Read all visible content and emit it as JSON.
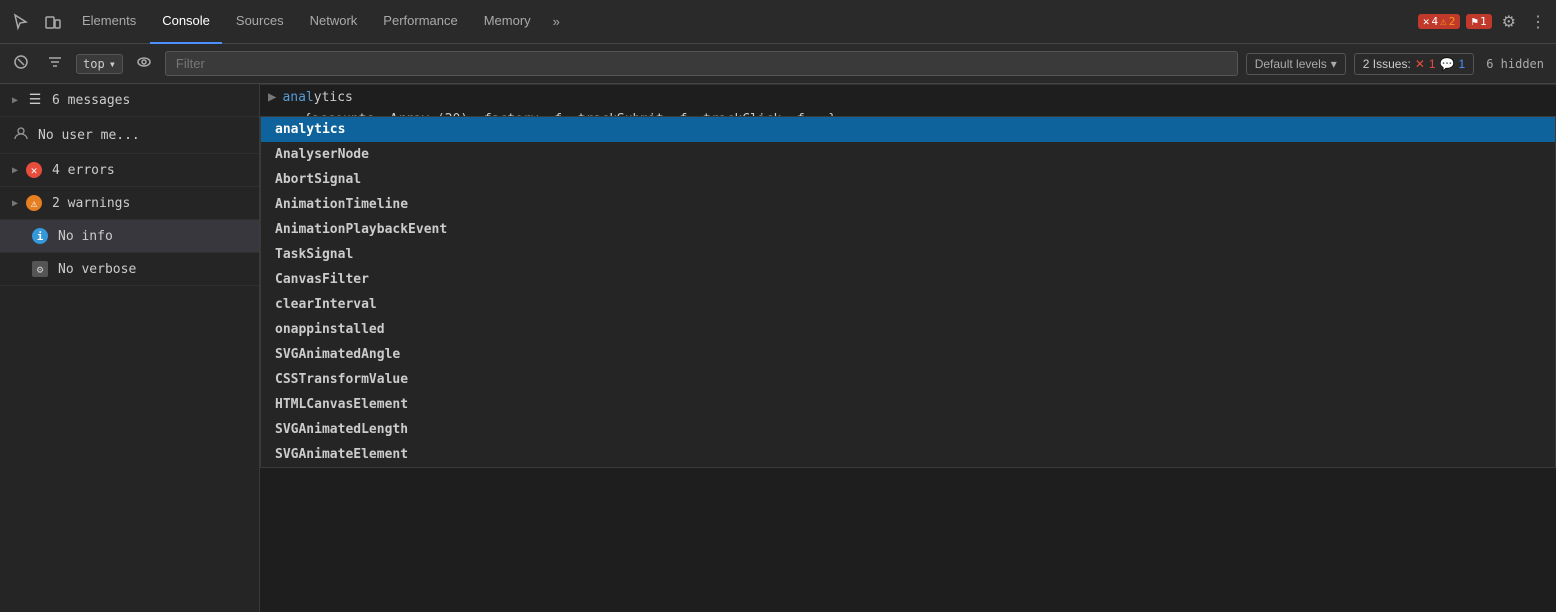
{
  "tabs": {
    "items": [
      {
        "label": "Elements",
        "active": false
      },
      {
        "label": "Console",
        "active": true
      },
      {
        "label": "Sources",
        "active": false
      },
      {
        "label": "Network",
        "active": false
      },
      {
        "label": "Performance",
        "active": false
      },
      {
        "label": "Memory",
        "active": false
      }
    ],
    "more_label": "»"
  },
  "top_right": {
    "error_count": "4",
    "warn_count": "2",
    "flag_count": "1",
    "issues_label": "2 Issues:",
    "issues_error": "1",
    "issues_msg": "1",
    "hidden_label": "6 hidden"
  },
  "toolbar": {
    "filter_placeholder": "Filter",
    "context_label": "top",
    "default_levels_label": "Default levels",
    "issues_badge_label": "2 Issues:",
    "issues_badge_error": "1",
    "issues_badge_msg": "1",
    "hidden_count_label": "6 hidden"
  },
  "sidebar": {
    "items": [
      {
        "icon": "list",
        "label": "6 messages",
        "type": "list",
        "count": ""
      },
      {
        "icon": "user",
        "label": "No user me...",
        "type": "user",
        "count": ""
      },
      {
        "icon": "error",
        "label": "4 errors",
        "type": "error",
        "count": ""
      },
      {
        "icon": "warn",
        "label": "2 warnings",
        "type": "warn",
        "count": ""
      },
      {
        "icon": "info",
        "label": "No info",
        "type": "info",
        "count": ""
      },
      {
        "icon": "verbose",
        "label": "No verbose",
        "type": "verbose",
        "count": ""
      }
    ]
  },
  "console": {
    "input_text": "anal",
    "input_text2": "ytics",
    "output_text": "(20), factory: f, trackSubmit: f, trackClick: f, …}"
  },
  "autocomplete": {
    "items": [
      {
        "label": "analytics",
        "highlighted": true
      },
      {
        "label": "AnalyserNode",
        "highlighted": false
      },
      {
        "label": "AbortSignal",
        "highlighted": false
      },
      {
        "label": "AnimationTimeline",
        "highlighted": false
      },
      {
        "label": "AnimationPlaybackEvent",
        "highlighted": false
      },
      {
        "label": "TaskSignal",
        "highlighted": false
      },
      {
        "label": "CanvasFilter",
        "highlighted": false
      },
      {
        "label": "clearInterval",
        "highlighted": false
      },
      {
        "label": "onappinstalled",
        "highlighted": false
      },
      {
        "label": "SVGAnimatedAngle",
        "highlighted": false
      },
      {
        "label": "CSSTransformValue",
        "highlighted": false
      },
      {
        "label": "HTMLCanvasElement",
        "highlighted": false
      },
      {
        "label": "SVGAnimatedLength",
        "highlighted": false
      },
      {
        "label": "SVGAnimateElement",
        "highlighted": false
      }
    ]
  }
}
